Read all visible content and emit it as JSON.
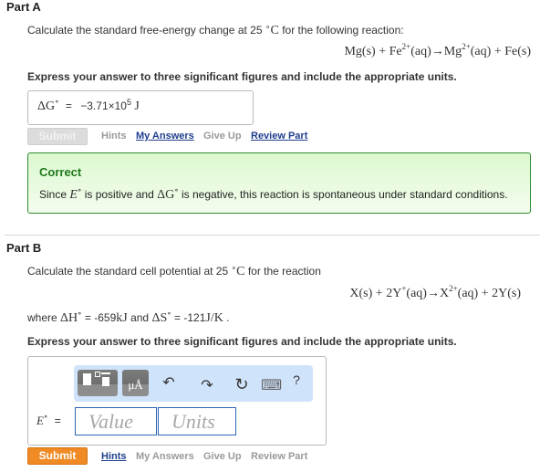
{
  "partA": {
    "title": "Part A",
    "prompt_pre": "Calculate the standard free-energy change at 25",
    "prompt_unit": "C",
    "prompt_post": "for the following reaction:",
    "reaction": {
      "r1": "Mg(s)",
      "plus1": "+",
      "r2": "Fe",
      "r2_charge": "2+",
      "r2_state": "(aq)",
      "arrow": "→",
      "p1": "Mg",
      "p1_charge": "2+",
      "p1_state": "(aq)",
      "plus2": "+",
      "p2": "Fe(s)"
    },
    "instruction": "Express your answer to three significant figures and include the appropriate units.",
    "answer_label": "ΔG",
    "answer_label_sup": "∘",
    "answer_eq": "=",
    "answer_value_mantissa": "−3.71×10",
    "answer_value_exp": "5",
    "answer_unit": "J",
    "actions": {
      "submit": "Submit",
      "hints": "Hints",
      "my_answers": "My Answers",
      "give_up": "Give Up",
      "review_part": "Review Part"
    },
    "feedback": {
      "title": "Correct",
      "text_1": "Since",
      "sym_E": "E",
      "text_2": "is positive and",
      "sym_dG": "ΔG",
      "text_3": "is negative, this reaction is spontaneous under standard conditions."
    }
  },
  "partB": {
    "title": "Part B",
    "prompt_pre": "Calculate the standard cell potential at 25",
    "prompt_unit": "C",
    "prompt_post": "for the reaction",
    "reaction": {
      "r1": "X(s)",
      "plus1": "+",
      "r2": "2Y",
      "r2_charge": "+",
      "r2_state": "(aq)",
      "arrow": "→",
      "p1": "X",
      "p1_charge": "2+",
      "p1_state": "(aq)",
      "plus2": "+",
      "p2": "2Y(s)"
    },
    "given": {
      "where": "where",
      "dH_sym": "ΔH",
      "dH_val": "= -659",
      "dH_unit": "kJ",
      "and": "and",
      "dS_sym": "ΔS",
      "dS_val": "= -121",
      "dS_unit": "J/K",
      "end": "."
    },
    "instruction": "Express your answer to three significant figures and include the appropriate units.",
    "toolbar": {
      "templates_icon": "templates-icon",
      "units_icon_label": "μÅ",
      "undo_icon": "↶",
      "redo_icon": "↷",
      "reset_icon": "↻",
      "keyboard_icon": "⌨",
      "help_label": "?"
    },
    "answer_label": "E",
    "answer_eq": "=",
    "value_placeholder": "Value",
    "units_placeholder": "Units",
    "actions": {
      "submit": "Submit",
      "hints": "Hints",
      "my_answers": "My Answers",
      "give_up": "Give Up",
      "review_part": "Review Part"
    }
  },
  "colors": {
    "submit_active": "#ef8a25",
    "submit_disabled": "#dcdcdc",
    "link_blue": "#1e3e8e",
    "correct_green": "#1d7a1d",
    "toolbar_bg": "#cfe3fb",
    "field_border": "#2c64b5"
  }
}
